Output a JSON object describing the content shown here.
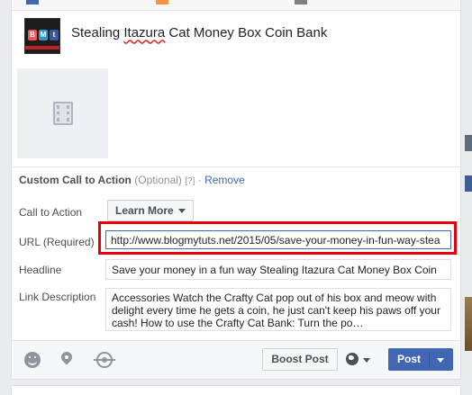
{
  "product": {
    "title_before": "Stealing ",
    "title_misspelled": "Itazura",
    "title_after": " Cat Money Box Coin Bank",
    "logo_letters": [
      "B",
      "M",
      "t"
    ]
  },
  "cta": {
    "heading": "Custom Call to Action",
    "optional": "(Optional)",
    "help": "[?]",
    "separator": " · ",
    "remove": "Remove",
    "label": "Call to Action",
    "button_label": "Learn More"
  },
  "url": {
    "label": "URL (Required)",
    "value": "http://www.blogmytuts.net/2015/05/save-your-money-in-fun-way-stea"
  },
  "headline": {
    "label": "Headline",
    "value": "Save your money in a fun way Stealing Itazura Cat Money Box Coin"
  },
  "link_description": {
    "label": "Link Description",
    "value": " Accessories Watch the Crafty Cat pop out of his box and meow with delight every time he gets a coin, he just can't keep his paws off your cash! How to use the Crafty Cat Bank: Turn the po…"
  },
  "footer": {
    "boost_label": "Boost Post",
    "post_label": "Post",
    "icons": [
      "smile-icon",
      "location-pin-icon",
      "target-icon",
      "globe-icon"
    ]
  },
  "colors": {
    "fb_blue": "#4267b2",
    "highlight_red": "#e8000b",
    "link_blue": "#4267b2"
  }
}
